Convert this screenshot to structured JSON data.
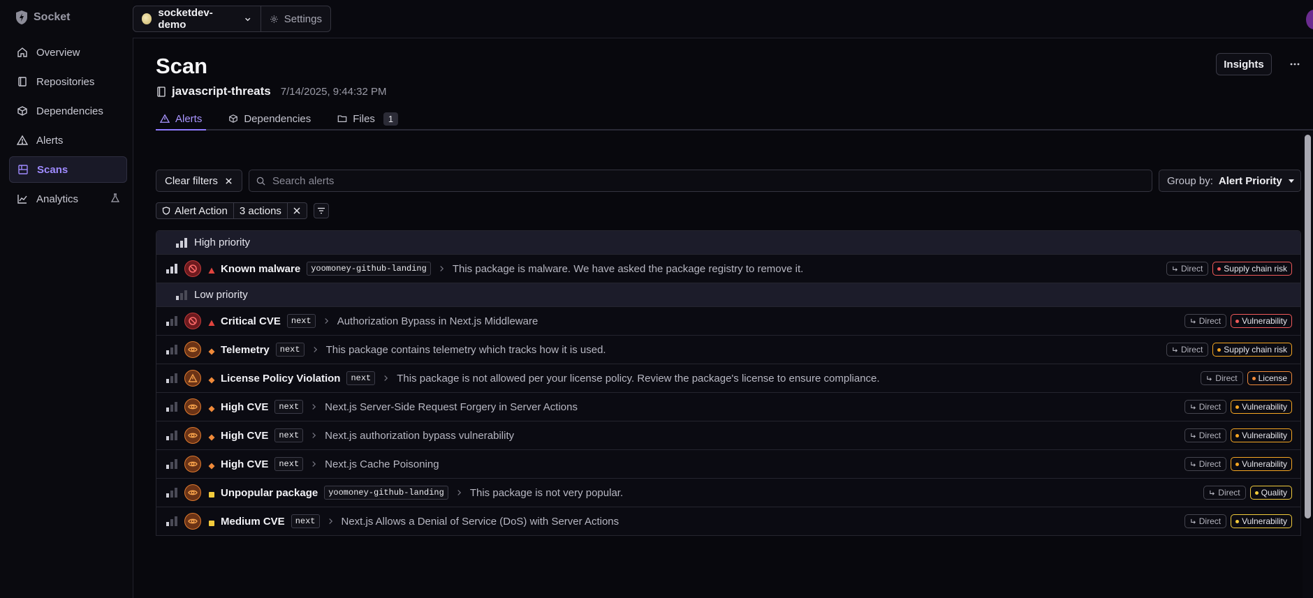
{
  "brand": {
    "name": "Socket"
  },
  "sidebar": {
    "items": [
      {
        "label": "Overview",
        "icon": "home-icon"
      },
      {
        "label": "Repositories",
        "icon": "book-icon"
      },
      {
        "label": "Dependencies",
        "icon": "package-icon"
      },
      {
        "label": "Alerts",
        "icon": "alert-triangle-icon"
      },
      {
        "label": "Scans",
        "icon": "scan-icon",
        "active": true
      },
      {
        "label": "Analytics",
        "icon": "chart-line-icon",
        "beta_icon": "flask-icon"
      }
    ]
  },
  "topbar": {
    "org": "socketdev-demo",
    "settings": "Settings"
  },
  "page": {
    "title": "Scan",
    "insights": "Insights",
    "more": "···"
  },
  "scan": {
    "repo": "javascript-threats",
    "date": "7/14/2025, 9:44:32 PM"
  },
  "tabs": [
    {
      "label": "Alerts",
      "active": true
    },
    {
      "label": "Dependencies"
    },
    {
      "label": "Files",
      "count": "1"
    }
  ],
  "filters": {
    "clear": "Clear filters",
    "search_placeholder": "Search alerts",
    "group_by_label": "Group by:",
    "group_by_value": "Alert Priority",
    "chip_label": "Alert Action",
    "chip_value": "3 actions"
  },
  "colors": {
    "accent": "#9f8bff",
    "critical": "#e0443e",
    "high": "#f08a3a",
    "medium": "#f2cb3c",
    "supply_chain": "#f05a5a",
    "vulnerability": "#f5a623",
    "license": "#f08a3a",
    "quality": "#f2cb3c"
  },
  "groups": [
    {
      "title": "High priority",
      "level": 3,
      "rows": [
        {
          "name": "Known malware",
          "pkg": "yoomoney-github-landing",
          "desc": "This package is malware. We have asked the package registry to remove it.",
          "severity": "critical",
          "icon": "block-icon",
          "direct": "Direct",
          "type": "Supply chain risk",
          "type_color": "#f05a5a",
          "prio": 3
        }
      ]
    },
    {
      "title": "Low priority",
      "level": 1,
      "rows": [
        {
          "name": "Critical CVE",
          "pkg": "next",
          "desc": "Authorization Bypass in Next.js Middleware",
          "severity": "critical",
          "icon": "block-icon",
          "direct": "Direct",
          "type": "Vulnerability",
          "type_color": "#f05a5a",
          "prio": 1
        },
        {
          "name": "Telemetry",
          "pkg": "next",
          "desc": "This package contains telemetry which tracks how it is used.",
          "severity": "high",
          "icon": "eye-icon",
          "direct": "Direct",
          "type": "Supply chain risk",
          "type_color": "#f5a623",
          "prio": 1
        },
        {
          "name": "License Policy Violation",
          "pkg": "next",
          "desc": "This package is not allowed per your license policy. Review the package's license to ensure compliance.",
          "severity": "high",
          "icon": "warning-icon",
          "direct": "Direct",
          "type": "License",
          "type_color": "#f08a3a",
          "prio": 1
        },
        {
          "name": "High CVE",
          "pkg": "next",
          "desc": "Next.js Server-Side Request Forgery in Server Actions",
          "severity": "high",
          "icon": "eye-icon",
          "direct": "Direct",
          "type": "Vulnerability",
          "type_color": "#f5a623",
          "prio": 1
        },
        {
          "name": "High CVE",
          "pkg": "next",
          "desc": "Next.js authorization bypass vulnerability",
          "severity": "high",
          "icon": "eye-icon",
          "direct": "Direct",
          "type": "Vulnerability",
          "type_color": "#f5a623",
          "prio": 1
        },
        {
          "name": "High CVE",
          "pkg": "next",
          "desc": "Next.js Cache Poisoning",
          "severity": "high",
          "icon": "eye-icon",
          "direct": "Direct",
          "type": "Vulnerability",
          "type_color": "#f5a623",
          "prio": 1
        },
        {
          "name": "Unpopular package",
          "pkg": "yoomoney-github-landing",
          "desc": "This package is not very popular.",
          "severity": "medium",
          "icon": "eye-icon",
          "direct": "Direct",
          "type": "Quality",
          "type_color": "#f2cb3c",
          "prio": 1
        },
        {
          "name": "Medium CVE",
          "pkg": "next",
          "desc": "Next.js Allows a Denial of Service (DoS) with Server Actions",
          "severity": "medium",
          "icon": "eye-icon",
          "direct": "Direct",
          "type": "Vulnerability",
          "type_color": "#f2cb3c",
          "prio": 1
        }
      ]
    }
  ]
}
